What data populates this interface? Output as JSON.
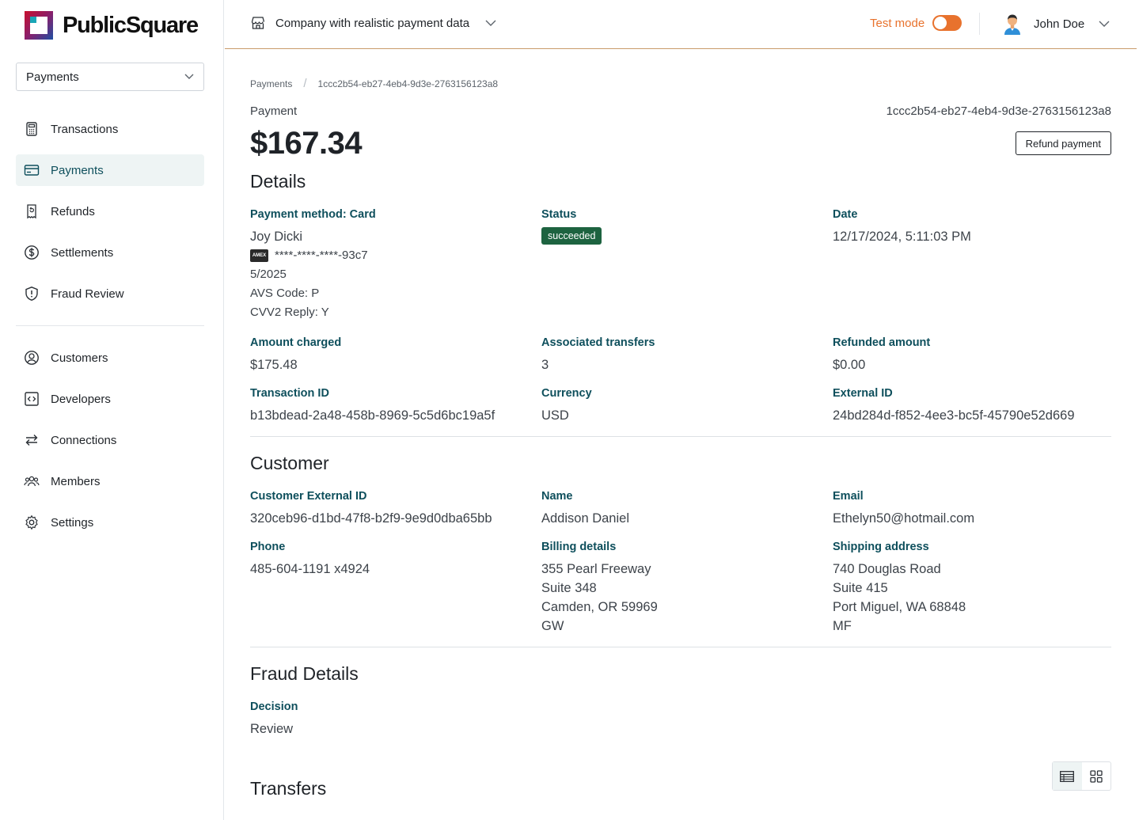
{
  "brand": {
    "name": "PublicSquare"
  },
  "app_select": {
    "value": "Payments"
  },
  "nav": {
    "primary": [
      {
        "label": "Transactions",
        "icon": "calculator-icon"
      },
      {
        "label": "Payments",
        "icon": "credit-card-icon",
        "active": true
      },
      {
        "label": "Refunds",
        "icon": "refund-icon"
      },
      {
        "label": "Settlements",
        "icon": "dollar-circle-icon"
      },
      {
        "label": "Fraud Review",
        "icon": "shield-alert-icon"
      }
    ],
    "secondary": [
      {
        "label": "Customers",
        "icon": "user-circle-icon"
      },
      {
        "label": "Developers",
        "icon": "code-icon"
      },
      {
        "label": "Connections",
        "icon": "arrows-swap-icon"
      },
      {
        "label": "Members",
        "icon": "users-icon"
      },
      {
        "label": "Settings",
        "icon": "gear-icon"
      }
    ]
  },
  "header": {
    "company": "Company with realistic payment data",
    "test_mode_label": "Test mode",
    "test_mode_on": true,
    "user_name": "John Doe"
  },
  "breadcrumb": [
    "Payments",
    "1ccc2b54-eb27-4eb4-9d3e-2763156123a8"
  ],
  "payment": {
    "kicker": "Payment",
    "id": "1ccc2b54-eb27-4eb4-9d3e-2763156123a8",
    "amount": "$167.34",
    "refund_button": "Refund payment"
  },
  "details": {
    "title": "Details",
    "payment_method_label": "Payment method: Card",
    "cardholder": "Joy Dicki",
    "card_brand": "AMEX",
    "card_number": "****-****-****-93c7",
    "expiry": "5/2025",
    "avs": "AVS Code: P",
    "cvv": "CVV2 Reply: Y",
    "status_label": "Status",
    "status_value": "succeeded",
    "date_label": "Date",
    "date_value": "12/17/2024, 5:11:03 PM",
    "amount_charged_label": "Amount charged",
    "amount_charged_value": "$175.48",
    "assoc_transfers_label": "Associated transfers",
    "assoc_transfers_value": "3",
    "refunded_label": "Refunded amount",
    "refunded_value": "$0.00",
    "txn_id_label": "Transaction ID",
    "txn_id_value": "b13bdead-2a48-458b-8969-5c5d6bc19a5f",
    "currency_label": "Currency",
    "currency_value": "USD",
    "external_id_label": "External ID",
    "external_id_value": "24bd284d-f852-4ee3-bc5f-45790e52d669"
  },
  "customer": {
    "title": "Customer",
    "ext_id_label": "Customer External ID",
    "ext_id_value": "320ceb96-d1bd-47f8-b2f9-9e9d0dba65bb",
    "name_label": "Name",
    "name_value": "Addison Daniel",
    "email_label": "Email",
    "email_value": "Ethelyn50@hotmail.com",
    "phone_label": "Phone",
    "phone_value": "485-604-1191 x4924",
    "billing_label": "Billing details",
    "billing_lines": [
      "355 Pearl Freeway",
      "Suite 348",
      "Camden, OR 59969",
      "GW"
    ],
    "shipping_label": "Shipping address",
    "shipping_lines": [
      "740 Douglas Road",
      "Suite 415",
      "Port Miguel, WA 68848",
      "MF"
    ]
  },
  "fraud": {
    "title": "Fraud Details",
    "decision_label": "Decision",
    "decision_value": "Review"
  },
  "transfers": {
    "title": "Transfers"
  },
  "colors": {
    "accent": "#0e4f5c",
    "test_mode": "#e8722d",
    "success": "#1d6340",
    "active_nav_bg": "#eef4f4"
  }
}
